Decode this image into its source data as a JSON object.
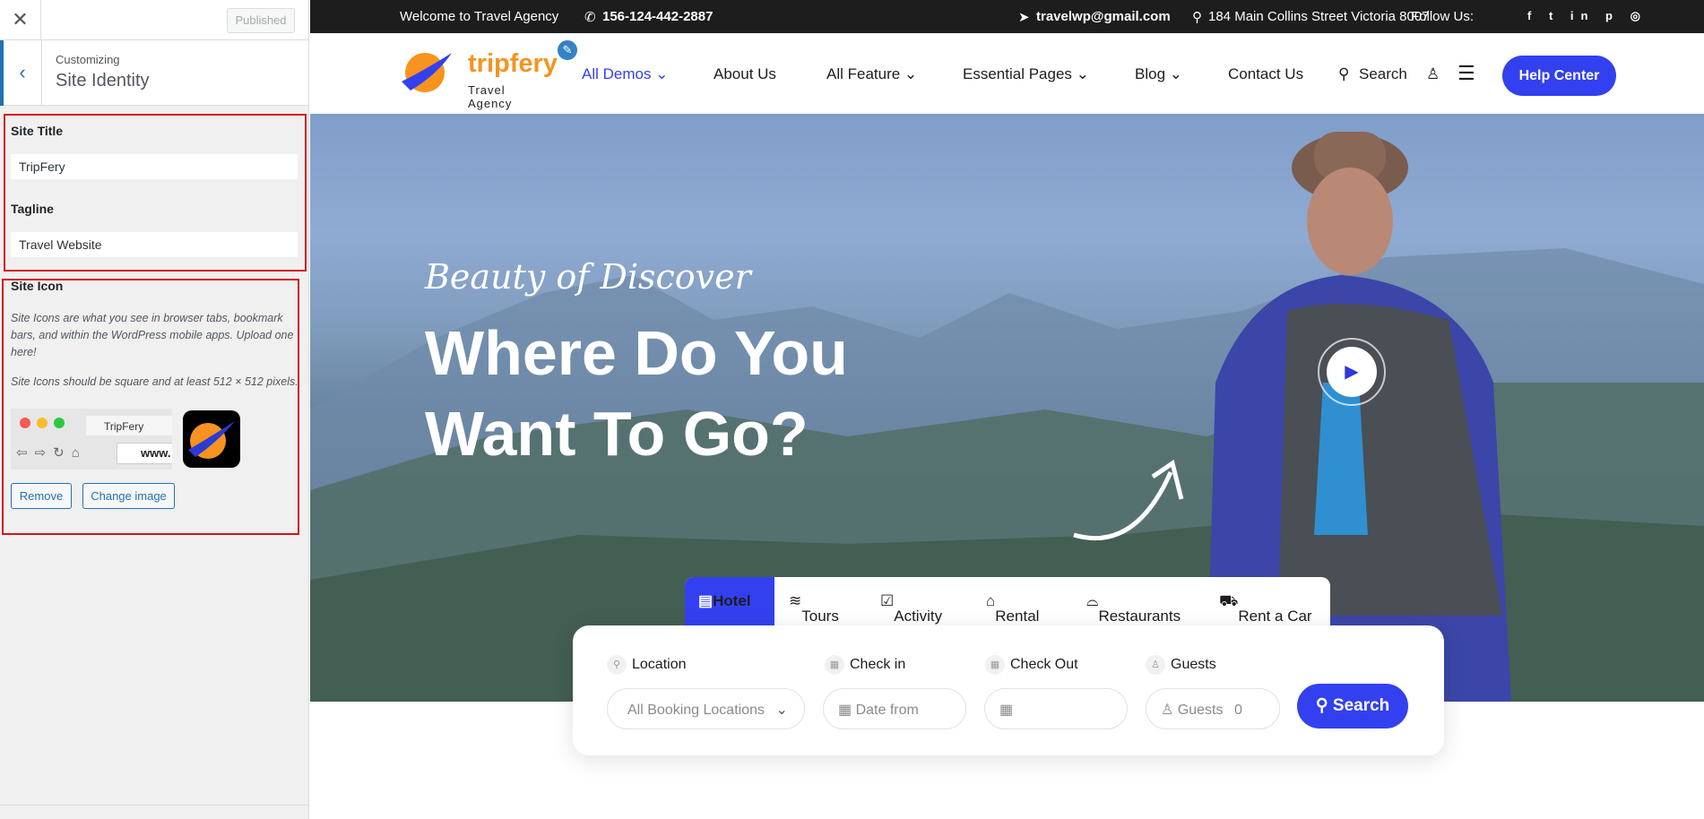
{
  "customizer": {
    "close_icon": "close-icon",
    "published_label": "Published",
    "breadcrumb": "Customizing",
    "section_title": "Site Identity",
    "site_title_label": "Site Title",
    "site_title_value": "TripFery",
    "tagline_label": "Tagline",
    "tagline_value": "Travel Website",
    "site_icon_label": "Site Icon",
    "site_icon_desc1": "Site Icons are what you see in browser tabs, bookmark bars, and within the WordPress mobile apps. Upload one here!",
    "site_icon_desc2": "Site Icons should be square and at least 512 × 512 pixels.",
    "preview_tab": "TripFery",
    "preview_url": "www.",
    "remove_label": "Remove",
    "change_label": "Change image"
  },
  "topbar": {
    "welcome": "Welcome to Travel Agency",
    "phone": "156-124-442-2887",
    "email": "travelwp@gmail.com",
    "address": "184 Main Collins Street Victoria 8007",
    "follow": "Follow Us:"
  },
  "header": {
    "logo_text": "tripfery",
    "logo_sub": "Travel Agency",
    "nav": [
      "All Demos",
      "About Us",
      "All Feature",
      "Essential Pages",
      "Blog",
      "Contact Us"
    ],
    "search_label": "Search",
    "help_label": "Help Center"
  },
  "hero": {
    "tagline": "Beauty of Discover",
    "title_line1": "Where Do You",
    "title_line2": "Want To Go?"
  },
  "booking": {
    "tabs": [
      "Hotel",
      "Tours",
      "Activity",
      "Rental",
      "Restaurants",
      "Rent a Car"
    ],
    "fields": {
      "location_label": "Location",
      "location_value": "All Booking Locations",
      "checkin_label": "Check in",
      "checkin_placeholder": "Date from",
      "checkout_label": "Check Out",
      "guests_label": "Guests",
      "guests_placeholder": "Guests",
      "guests_value": "0"
    },
    "search_label": "Search"
  },
  "colors": {
    "accent": "#3340f0",
    "wp_blue": "#2271b1",
    "highlight_red": "#d3131b"
  }
}
